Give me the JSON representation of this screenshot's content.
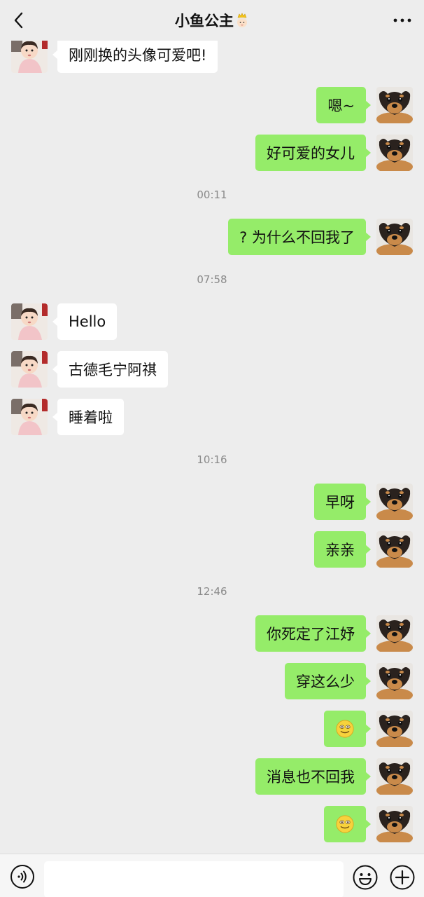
{
  "header": {
    "back_icon": "chevron-left-icon",
    "title": "小鱼公主",
    "title_icon": "princess-emoji-icon",
    "more_icon": "ellipsis-icon"
  },
  "messages": [
    {
      "side": "left",
      "text": "刚刚换的头像可爱吧!",
      "avatar": "girl-avatar"
    },
    {
      "side": "right",
      "text": "嗯~",
      "avatar": "dog-avatar"
    },
    {
      "side": "right",
      "text": "好可爱的女儿",
      "avatar": "dog-avatar"
    },
    {
      "time": "00:11"
    },
    {
      "side": "right",
      "text": "? 为什么不回我了",
      "avatar": "dog-avatar"
    },
    {
      "time": "07:58"
    },
    {
      "side": "left",
      "text": "Hello",
      "avatar": "girl-avatar"
    },
    {
      "side": "left",
      "text": "古德毛宁阿祺",
      "avatar": "girl-avatar"
    },
    {
      "side": "left",
      "text": "睡着啦",
      "avatar": "girl-avatar"
    },
    {
      "time": "10:16"
    },
    {
      "side": "right",
      "text": "早呀",
      "avatar": "dog-avatar"
    },
    {
      "side": "right",
      "text": "亲亲",
      "avatar": "dog-avatar"
    },
    {
      "time": "12:46"
    },
    {
      "side": "right",
      "text": "你死定了江妤",
      "avatar": "dog-avatar"
    },
    {
      "side": "right",
      "text": "穿这么少",
      "avatar": "dog-avatar"
    },
    {
      "side": "right",
      "emoji": "smile-emoji-icon",
      "avatar": "dog-avatar"
    },
    {
      "side": "right",
      "text": "消息也不回我",
      "avatar": "dog-avatar"
    },
    {
      "side": "right",
      "emoji": "smile-emoji-icon",
      "avatar": "dog-avatar"
    }
  ],
  "bottom_bar": {
    "voice_icon": "voice-icon",
    "input_value": "",
    "emoji_icon": "emoji-icon",
    "plus_icon": "plus-circle-icon"
  },
  "colors": {
    "background": "#ededed",
    "self_bubble": "#95ec69",
    "other_bubble": "#ffffff",
    "timestamp": "#8a8a8a"
  }
}
